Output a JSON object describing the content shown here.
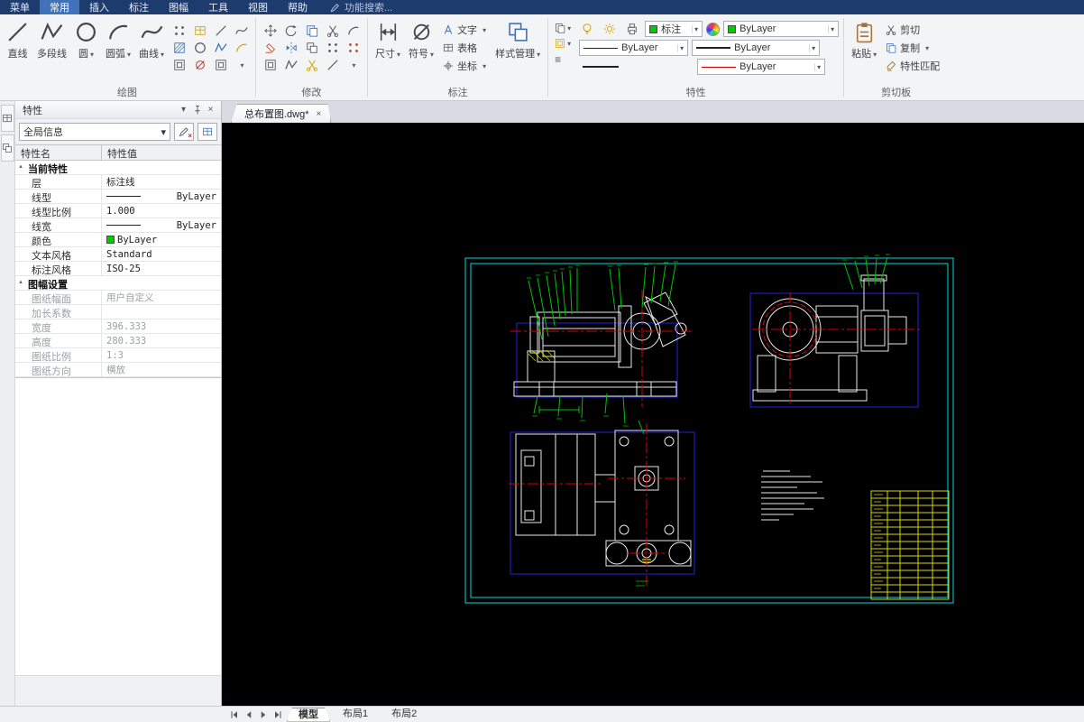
{
  "theme": {
    "menubar_bg": "#1d3b6d",
    "active_tab_bg": "#4272b8",
    "ribbon_bg": "#f3f4f6",
    "canvas_bg": "#000000",
    "frame_color": "#00d9d9",
    "view_box_color": "#2222dd",
    "geometry_color": "#e8e8e8",
    "annotation_color": "#00c400",
    "centerline_color": "#e00000",
    "titleblock_color": "#d6d600",
    "layer_swatch_color": "#00cc00"
  },
  "icons": {
    "search": "magnifier",
    "pencil": "pencil",
    "close": "×",
    "dropdown": "caret-down",
    "pin": "pin",
    "collapse": "triangle",
    "color_wheel": "rainbow-circle",
    "hamburger": "≡"
  },
  "menubar": {
    "items": [
      "菜单",
      "常用",
      "插入",
      "标注",
      "图幅",
      "工具",
      "视图",
      "帮助"
    ],
    "active": "常用",
    "search_placeholder": "功能搜索..."
  },
  "ribbon": {
    "draw": {
      "label": "绘图",
      "tools": [
        {
          "label": "直线"
        },
        {
          "label": "多段线"
        },
        {
          "label": "圆"
        },
        {
          "label": "圆弧"
        },
        {
          "label": "曲线"
        }
      ]
    },
    "modify": {
      "label": "修改"
    },
    "annotate": {
      "label": "标注",
      "tools": [
        {
          "label": "尺寸"
        },
        {
          "label": "符号"
        },
        {
          "label": "文字"
        },
        {
          "label": "表格"
        },
        {
          "label": "坐标"
        },
        {
          "label": "样式管理"
        }
      ]
    },
    "properties": {
      "label": "特性",
      "layer": "标注",
      "color": "ByLayer",
      "linetype": "ByLayer",
      "lineweight": "ByLayer",
      "linetype2": "ByLayer",
      "hamburger": "≡"
    },
    "clipboard": {
      "label": "剪切板",
      "tools": [
        {
          "label": "粘贴"
        },
        {
          "label": "剪切"
        },
        {
          "label": "复制"
        },
        {
          "label": "特性匹配"
        }
      ]
    }
  },
  "panel": {
    "title": "特性",
    "scope": "全局信息",
    "columns": [
      "特性名",
      "特性值"
    ],
    "rows": [
      {
        "name": "当前特性",
        "value": ""
      },
      {
        "name": "层",
        "value": "标注线"
      },
      {
        "name": "线型",
        "value": "ByLayer"
      },
      {
        "name": "线型比例",
        "value": "1.000"
      },
      {
        "name": "线宽",
        "value": "ByLayer"
      },
      {
        "name": "颜色",
        "value": "ByLayer"
      },
      {
        "name": "文本风格",
        "value": "Standard"
      },
      {
        "name": "标注风格",
        "value": "ISO-25"
      },
      {
        "name": "图幅设置",
        "value": ""
      },
      {
        "name": "图纸幅面",
        "value": "用户自定义"
      },
      {
        "name": "加长系数",
        "value": ""
      },
      {
        "name": "宽度",
        "value": "396.333"
      },
      {
        "name": "高度",
        "value": "280.333"
      },
      {
        "name": "图纸比例",
        "value": "1:3"
      },
      {
        "name": "图纸方向",
        "value": "横放"
      }
    ]
  },
  "document": {
    "tabs": [
      {
        "label": "总布置图.dwg*"
      }
    ]
  },
  "statusbar": {
    "tabs": [
      "模型",
      "布局1",
      "布局2"
    ],
    "active": "模型"
  }
}
